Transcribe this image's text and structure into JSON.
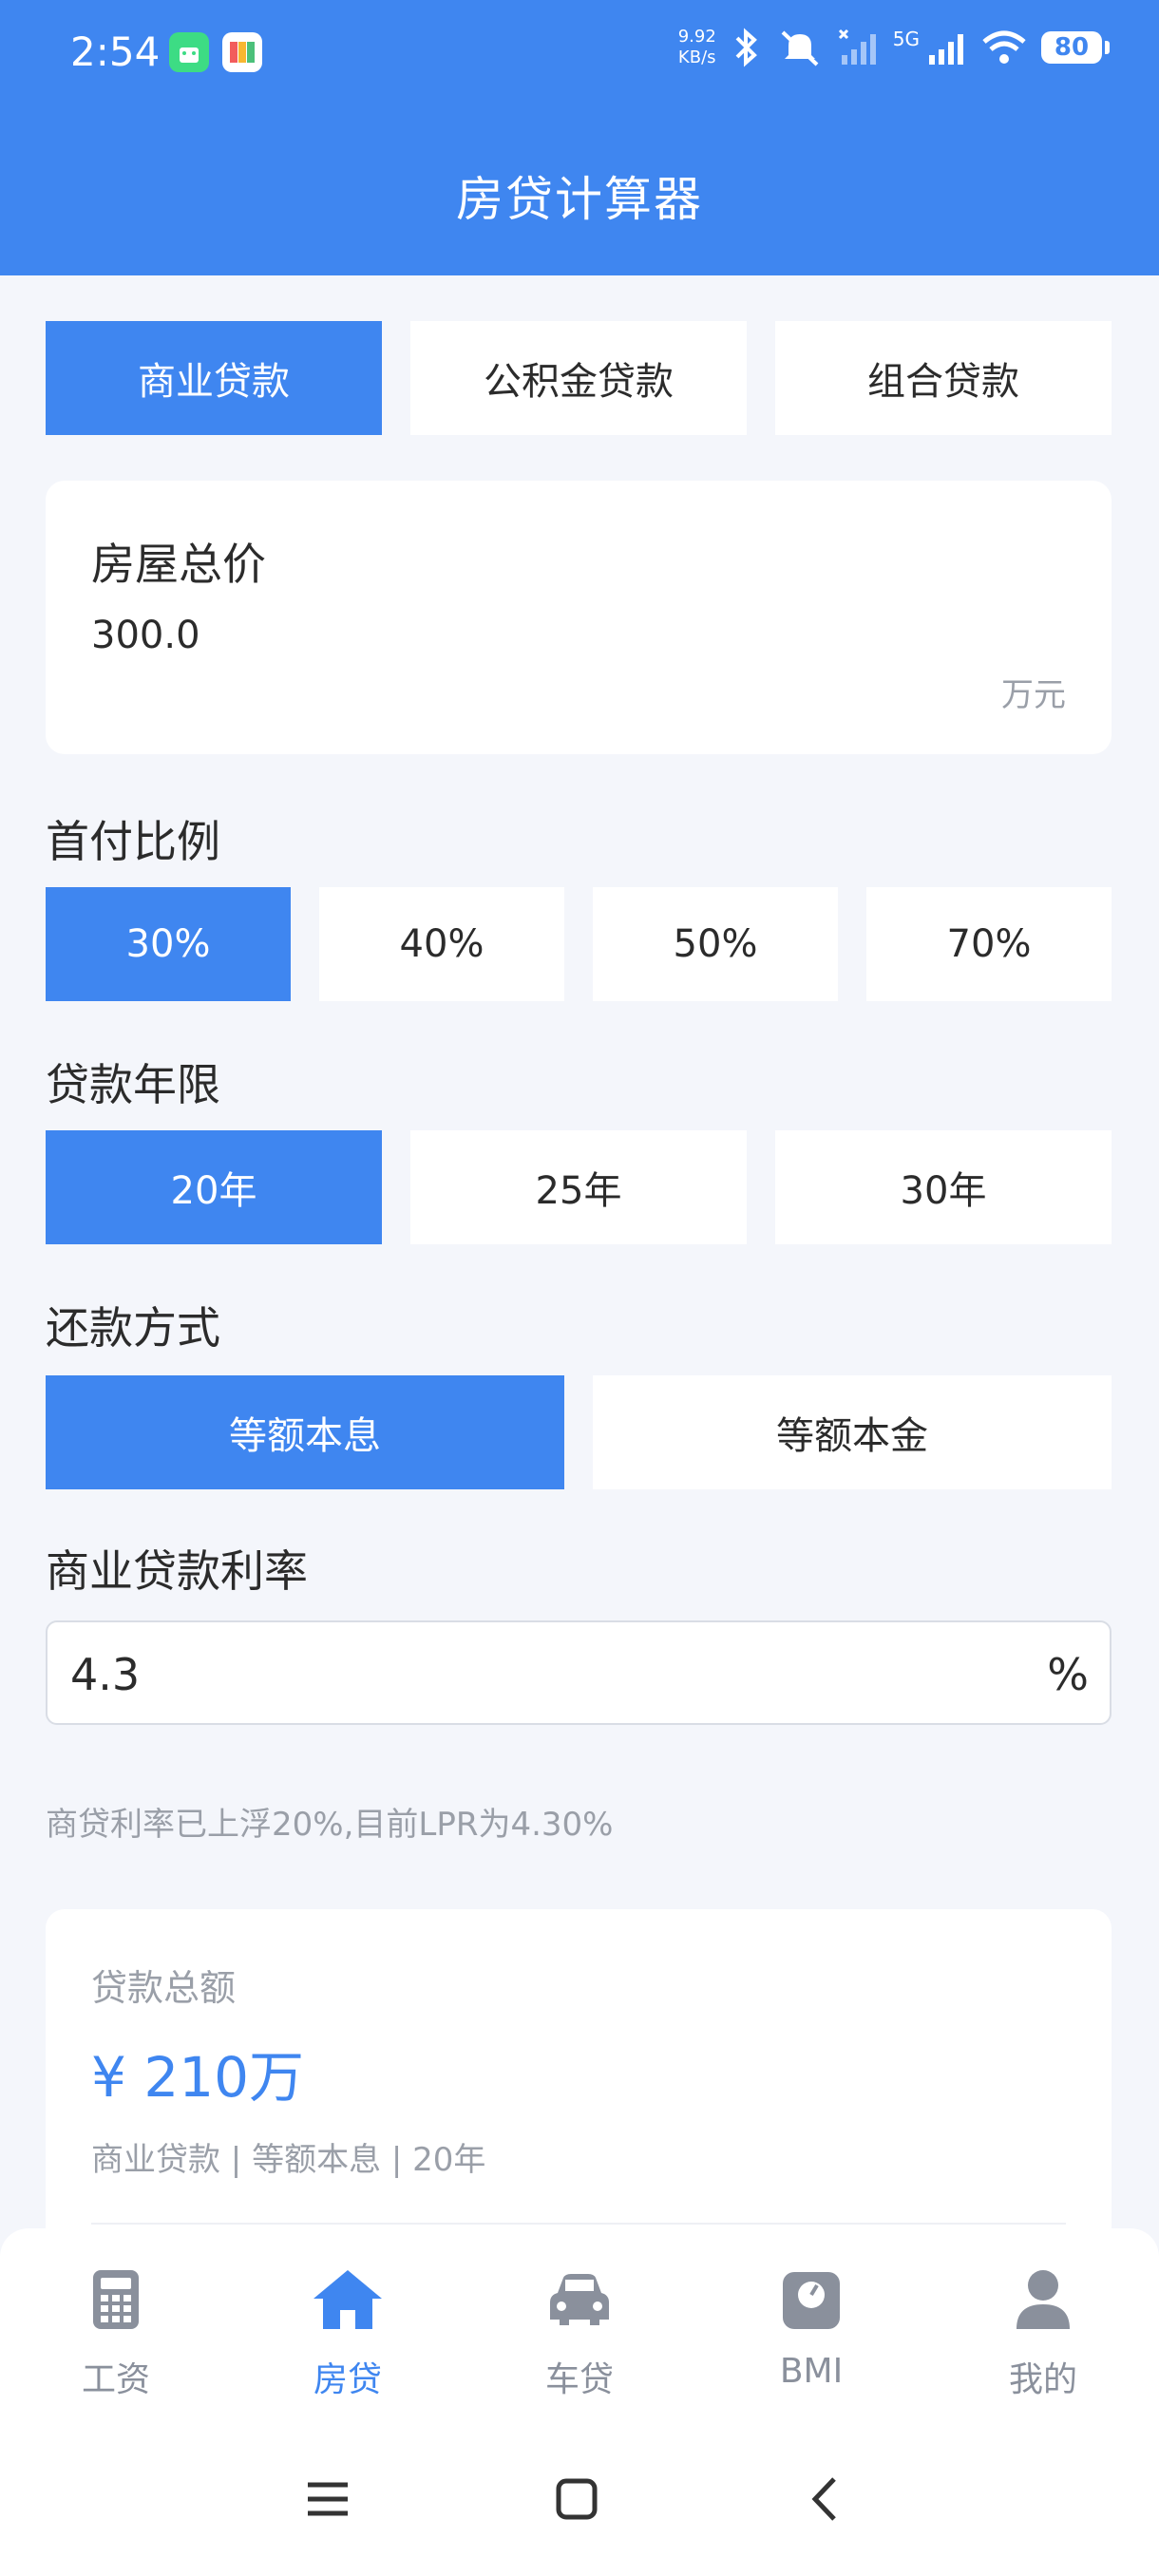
{
  "status_bar": {
    "time": "2:54",
    "net_speed_value": "9.92",
    "net_speed_unit": "KB/s",
    "network": "5G",
    "battery": "80"
  },
  "header": {
    "title": "房贷计算器"
  },
  "loan_types": [
    "商业贷款",
    "公积金贷款",
    "组合贷款"
  ],
  "house_price": {
    "label": "房屋总价",
    "value": "300.0",
    "unit": "万元"
  },
  "down_payment": {
    "label": "首付比例",
    "options": [
      "30%",
      "40%",
      "50%",
      "70%"
    ]
  },
  "loan_term": {
    "label": "贷款年限",
    "options": [
      "20年",
      "25年",
      "30年"
    ]
  },
  "repayment": {
    "label": "还款方式",
    "options": [
      "等额本息",
      "等额本金"
    ]
  },
  "rate": {
    "label": "商业贷款利率",
    "value": "4.3",
    "unit": "%",
    "hint": "商贷利率已上浮20%,目前LPR为4.30%"
  },
  "result": {
    "label": "贷款总额",
    "amount": "¥ 210万",
    "summary": "商业贷款 | 等额本息 | 20年"
  },
  "tabs": [
    "工资",
    "房贷",
    "车贷",
    "BMI",
    "我的"
  ],
  "colors": {
    "accent": "#3F86F0",
    "background": "#F4F6FB",
    "inactive": "#8A909C"
  }
}
